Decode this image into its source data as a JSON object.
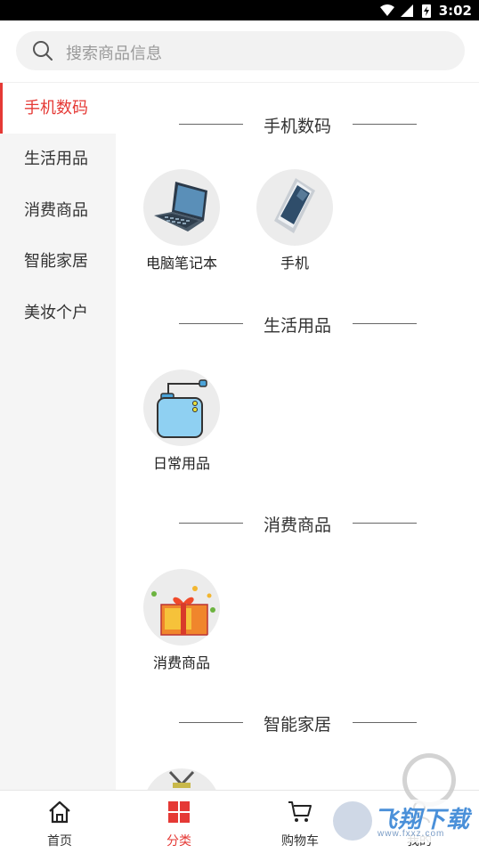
{
  "status_bar": {
    "time": "3:02"
  },
  "search": {
    "placeholder": "搜索商品信息"
  },
  "sidebar": {
    "items": [
      {
        "label": "手机数码",
        "active": true
      },
      {
        "label": "生活用品",
        "active": false
      },
      {
        "label": "消费商品",
        "active": false
      },
      {
        "label": "智能家居",
        "active": false
      },
      {
        "label": "美妆个户",
        "active": false
      }
    ]
  },
  "sections": [
    {
      "title": "手机数码",
      "items": [
        {
          "label": "电脑笔记本"
        },
        {
          "label": "手机"
        }
      ]
    },
    {
      "title": "生活用品",
      "items": [
        {
          "label": "日常用品"
        }
      ]
    },
    {
      "title": "消费商品",
      "items": [
        {
          "label": "消费商品"
        }
      ]
    },
    {
      "title": "智能家居",
      "items": []
    }
  ],
  "bottom_nav": {
    "items": [
      {
        "label": "首页",
        "icon": "home-icon"
      },
      {
        "label": "分类",
        "icon": "category-icon",
        "active": true
      },
      {
        "label": "购物车",
        "icon": "cart-icon"
      },
      {
        "label": "我的",
        "icon": "profile-icon"
      }
    ]
  },
  "watermark": {
    "text": "飞翔下载",
    "url": "www.fxxz.com"
  },
  "colors": {
    "accent": "#e53935",
    "sidebar_bg": "#f5f5f5",
    "search_bg": "#f2f2f2"
  }
}
